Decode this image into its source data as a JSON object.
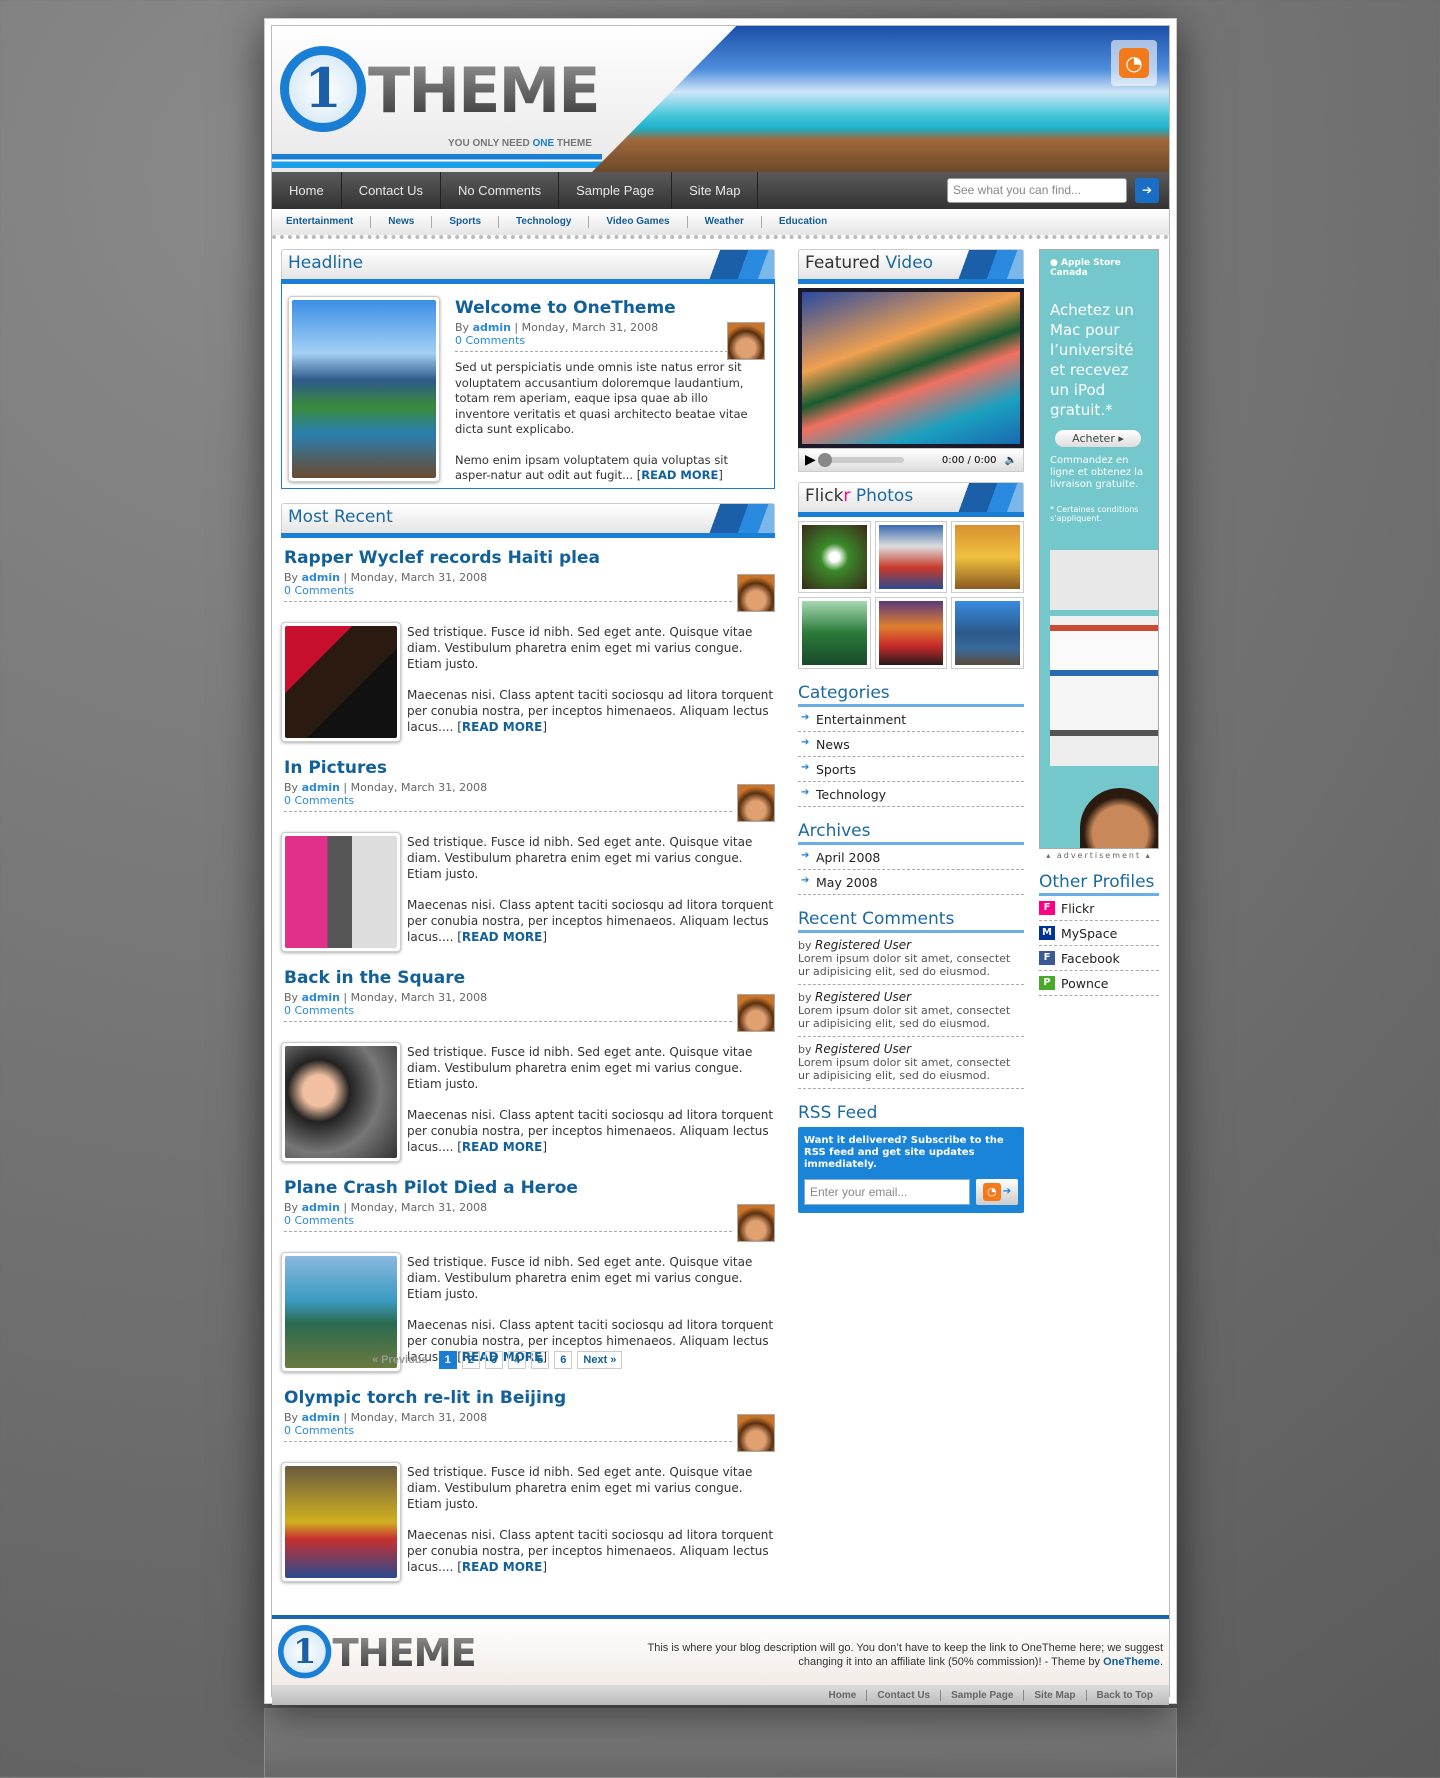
{
  "header": {
    "logo_text": "THEME",
    "logo_mark": "1",
    "tagline_pre": "YOU ONLY NEED ",
    "tagline_accent": "ONE",
    "tagline_post": " THEME",
    "rss_icon": "rss-icon"
  },
  "nav": {
    "items": [
      "Home",
      "Contact Us",
      "No Comments",
      "Sample Page",
      "Site Map"
    ],
    "search_placeholder": "See what you can find...",
    "search_button": "➔"
  },
  "subnav": {
    "items": [
      "Entertainment",
      "News",
      "Sports",
      "Technology",
      "Video Games",
      "Weather",
      "Education"
    ]
  },
  "headline": {
    "section_title": "Headline",
    "title": "Welcome to OneTheme",
    "by": "By ",
    "author": "admin",
    "date": " | Monday, March 31, 2008",
    "comments": "0 Comments",
    "p1": "Sed ut perspiciatis unde omnis iste natus error sit voluptatem accusantium doloremque laudantium, totam rem aperiam, eaque ipsa quae ab illo inventore veritatis et quasi architecto beatae vitae dicta sunt explicabo.",
    "p2": "Nemo enim ipsam voluptatem quia voluptas sit asper-natur aut odit aut fugit... ",
    "read_more": "READ MORE"
  },
  "recent": {
    "section_title": "Most Recent",
    "posts": [
      {
        "title": "Rapper Wyclef records Haiti plea",
        "author": "admin",
        "date": " | Monday, March 31, 2008",
        "comments": "0 Comments",
        "p1": "Sed tristique. Fusce id nibh. Sed eget ante. Quisque vitae diam. Vestibulum pharetra enim eget mi varius congue. Etiam justo.",
        "p2": "Maecenas nisi. Class aptent taciti sociosqu ad litora torquent per conubia nostra, per inceptos himenaeos. Aliquam lectus lacus.... ",
        "read_more": "READ MORE"
      },
      {
        "title": "In Pictures",
        "author": "admin",
        "date": " | Monday, March 31, 2008",
        "comments": "0 Comments",
        "p1": "Sed tristique. Fusce id nibh. Sed eget ante. Quisque vitae diam. Vestibulum pharetra enim eget mi varius congue. Etiam justo.",
        "p2": "Maecenas nisi. Class aptent taciti sociosqu ad litora torquent per conubia nostra, per inceptos himenaeos. Aliquam lectus lacus.... ",
        "read_more": "READ MORE"
      },
      {
        "title": "Back in the Square",
        "author": "admin",
        "date": " | Monday, March 31, 2008",
        "comments": "0 Comments",
        "p1": "Sed tristique. Fusce id nibh. Sed eget ante. Quisque vitae diam. Vestibulum pharetra enim eget mi varius congue. Etiam justo.",
        "p2": "Maecenas nisi. Class aptent taciti sociosqu ad litora torquent per conubia nostra, per inceptos himenaeos. Aliquam lectus lacus.... ",
        "read_more": "READ MORE"
      },
      {
        "title": "Plane Crash Pilot Died a Heroe",
        "author": "admin",
        "date": " | Monday, March 31, 2008",
        "comments": "0 Comments",
        "p1": "Sed tristique. Fusce id nibh. Sed eget ante. Quisque vitae diam. Vestibulum pharetra enim eget mi varius congue. Etiam justo.",
        "p2": "Maecenas nisi. Class aptent taciti sociosqu ad litora torquent per conubia nostra, per inceptos himenaeos. Aliquam lectus lacus.... ",
        "read_more": "READ MORE"
      },
      {
        "title": "Olympic torch re-lit in Beijing",
        "author": "admin",
        "date": " | Monday, March 31, 2008",
        "comments": "0 Comments",
        "p1": "Sed tristique. Fusce id nibh. Sed eget ante. Quisque vitae diam. Vestibulum pharetra enim eget mi varius congue. Etiam justo.",
        "p2": "Maecenas nisi. Class aptent taciti sociosqu ad litora torquent per conubia nostra, per inceptos himenaeos. Aliquam lectus lacus.... ",
        "read_more": "READ MORE"
      }
    ],
    "by": "By "
  },
  "pager": {
    "prev": "« Previous",
    "pages": [
      "1",
      "2",
      "3",
      "4",
      "5",
      "6"
    ],
    "current": "1",
    "next": "Next »"
  },
  "video": {
    "title_a": "Featured ",
    "title_b": "Video",
    "time": "0:00 / 0:00"
  },
  "flickr": {
    "title_a": "Flick",
    "title_r": "r",
    "title_b": " Photos"
  },
  "categories": {
    "title": "Categories",
    "items": [
      "Entertainment",
      "News",
      "Sports",
      "Technology"
    ]
  },
  "archives": {
    "title": "Archives",
    "items": [
      "April 2008",
      "May 2008"
    ]
  },
  "comments": {
    "title": "Recent Comments",
    "items": [
      {
        "by": "by ",
        "user": "Registered User",
        "text": "Lorem ipsum dolor sit amet, consectet ur adipisicing elit, sed do eiusmod."
      },
      {
        "by": "by ",
        "user": "Registered User",
        "text": "Lorem ipsum dolor sit amet, consectet ur adipisicing elit, sed do eiusmod."
      },
      {
        "by": "by ",
        "user": "Registered User",
        "text": "Lorem ipsum dolor sit amet, consectet ur adipisicing elit, sed do eiusmod."
      }
    ]
  },
  "rss": {
    "title": "RSS Feed",
    "text": "Want it delivered? Subscribe to the RSS feed and get site updates immediately.",
    "placeholder": "Enter your email..."
  },
  "ad": {
    "store": " Apple Store Canada",
    "headline": "Achetez un Mac pour l’université et recevez un iPod gratuit.*",
    "button": "Acheter ▸",
    "sub": "Commandez en ligne et obtenez la livraison gratuite.",
    "note": "* Certaines conditions s’appliquent.",
    "label": "▴ advertisement ▴"
  },
  "profiles": {
    "title": "Other Profiles",
    "items": [
      {
        "label": "Flickr",
        "icon": "flickr-icon",
        "color": "#ff0084"
      },
      {
        "label": "MySpace",
        "icon": "myspace-icon",
        "color": "#003399"
      },
      {
        "label": "Facebook",
        "icon": "facebook-icon",
        "color": "#3b5998"
      },
      {
        "label": "Pownce",
        "icon": "pownce-icon",
        "color": "#4aa82a"
      }
    ]
  },
  "footer": {
    "desc": "This is where your blog description will go. You don’t have to keep the link to OneTheme here; we suggest changing it into an affiliate link (50% commission)! - Theme by ",
    "link": "OneTheme",
    "end": ".",
    "links": [
      "Home",
      "Contact Us",
      "Sample Page",
      "Site Map",
      "Back to Top"
    ]
  },
  "colors": {
    "accent": "#1a7fd4",
    "link": "#12609a",
    "nav": "#333333"
  }
}
